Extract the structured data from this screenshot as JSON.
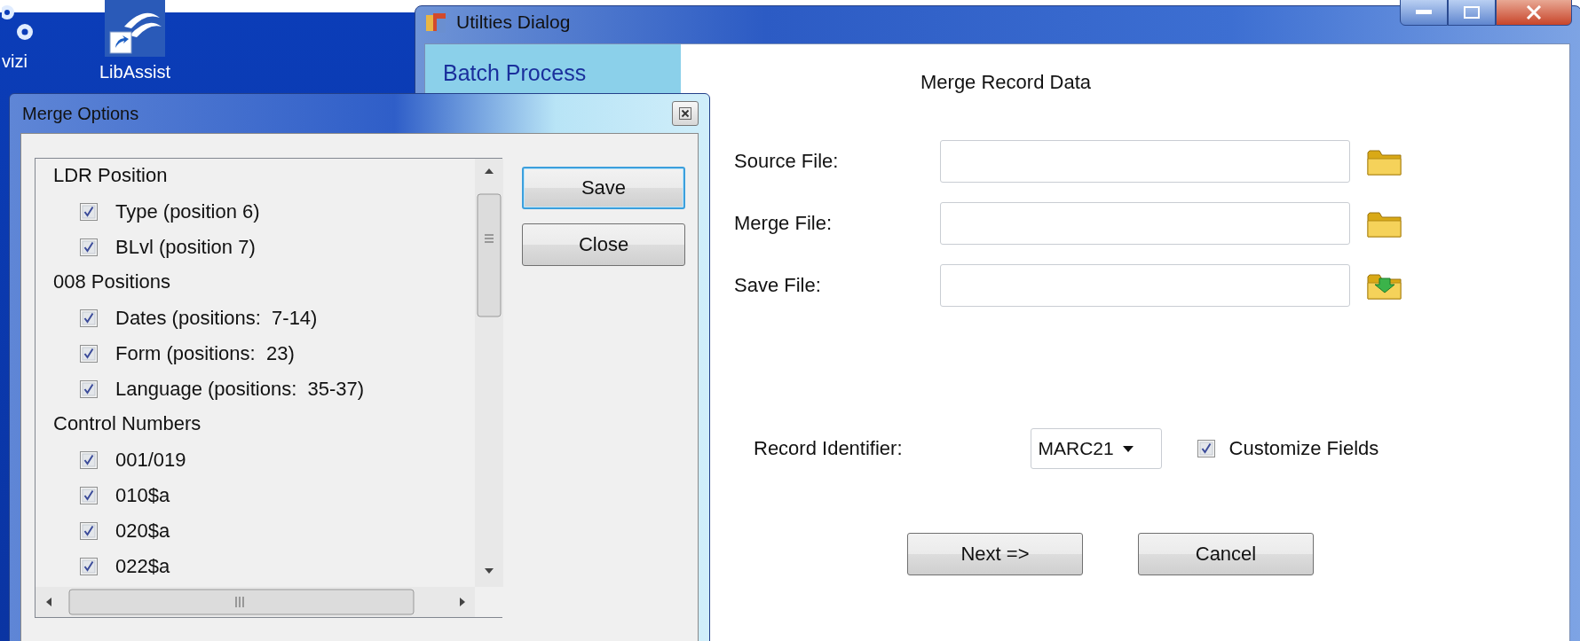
{
  "desktop_icons": [
    {
      "label": "vizi",
      "kind": "gears"
    },
    {
      "label": "LibAssist",
      "kind": "shortcut"
    }
  ],
  "utilities_window": {
    "title": "Utilties Dialog",
    "sidebar": {
      "items": [
        "Batch Process"
      ]
    },
    "heading": "Merge Record Data",
    "file_fields": [
      {
        "label": "Source File:",
        "kind": "open"
      },
      {
        "label": "Merge File:",
        "kind": "open"
      },
      {
        "label": "Save File:",
        "kind": "save"
      }
    ],
    "record_identifier": {
      "label": "Record Identifier:",
      "value": "MARC21"
    },
    "customize_fields": {
      "label": "Customize Fields",
      "checked": true
    },
    "buttons": [
      "Next =>",
      "Cancel"
    ]
  },
  "merge_options": {
    "title": "Merge Options",
    "groups": [
      {
        "label": "LDR Position",
        "items": [
          {
            "label": "Type (position 6)",
            "checked": true
          },
          {
            "label": "BLvl (position 7)",
            "checked": true
          }
        ]
      },
      {
        "label": "008 Positions",
        "items": [
          {
            "label": "Dates (positions:  7-14)",
            "checked": true
          },
          {
            "label": "Form (positions:  23)",
            "checked": true
          },
          {
            "label": "Language (positions:  35-37)",
            "checked": true
          }
        ]
      },
      {
        "label": "Control Numbers",
        "items": [
          {
            "label": "001/019",
            "checked": true
          },
          {
            "label": "010$a",
            "checked": true
          },
          {
            "label": "020$a",
            "checked": true
          },
          {
            "label": "022$a",
            "checked": true
          }
        ]
      }
    ],
    "buttons": [
      {
        "label": "Save",
        "focused": true
      },
      {
        "label": "Close",
        "focused": false
      }
    ]
  }
}
